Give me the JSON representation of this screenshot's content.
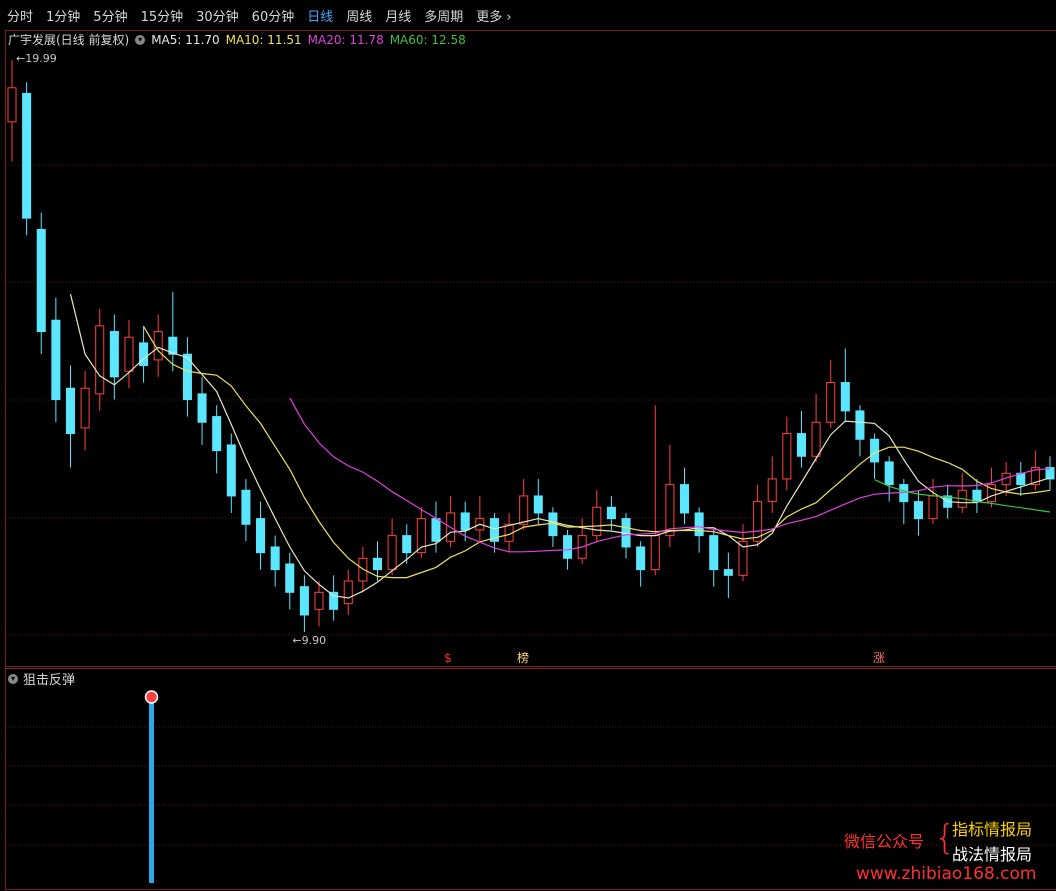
{
  "toolbar": {
    "tabs": [
      {
        "label": "分时",
        "active": false
      },
      {
        "label": "1分钟",
        "active": false
      },
      {
        "label": "5分钟",
        "active": false
      },
      {
        "label": "15分钟",
        "active": false
      },
      {
        "label": "30分钟",
        "active": false
      },
      {
        "label": "60分钟",
        "active": false
      },
      {
        "label": "日线",
        "active": true
      },
      {
        "label": "周线",
        "active": false
      },
      {
        "label": "月线",
        "active": false
      },
      {
        "label": "多周期",
        "active": false
      },
      {
        "label": "更多 ›",
        "active": false
      }
    ]
  },
  "main_chart": {
    "title": "广宇发展(日线 前复权)",
    "ma5": "MA5: 11.70",
    "ma10": "MA10: 11.51",
    "ma20": "MA20: 11.78",
    "ma60": "MA60: 12.58",
    "high_label": "19.99",
    "low_label": "9.90",
    "markers": [
      {
        "text": "$",
        "color": "#ff3030"
      },
      {
        "text": "榜",
        "color": "#ffd27a"
      },
      {
        "text": "涨",
        "color": "#ff7070"
      }
    ]
  },
  "sub_chart": {
    "title": "狙击反弹"
  },
  "watermark": {
    "left": "微信公众号",
    "line1": "指标情报局",
    "line2": "战法情报局",
    "url": "www.zhibiao168.com"
  },
  "colors": {
    "up": "#ff4040",
    "down": "#5ae6ff",
    "ma5": "#e8e8c0",
    "ma10": "#f0e060",
    "ma20": "#e040e0",
    "ma60": "#40c040",
    "active_tab": "#3fa9ff",
    "signal_bar": "#2da8e8"
  },
  "chart_data": {
    "type": "candlestick",
    "y_high": 19.99,
    "y_low": 9.9,
    "bars": [
      [
        18.9,
        19.5,
        19.99,
        18.2
      ],
      [
        19.4,
        17.2,
        19.6,
        16.9
      ],
      [
        17.0,
        15.2,
        17.3,
        14.8
      ],
      [
        15.4,
        14.0,
        15.8,
        13.6
      ],
      [
        14.2,
        13.4,
        14.6,
        12.8
      ],
      [
        13.5,
        14.2,
        14.5,
        13.1
      ],
      [
        14.1,
        15.3,
        15.6,
        13.8
      ],
      [
        15.2,
        14.4,
        15.5,
        14.0
      ],
      [
        14.5,
        15.1,
        15.4,
        14.2
      ],
      [
        15.0,
        14.6,
        15.3,
        14.3
      ],
      [
        14.7,
        15.2,
        15.5,
        14.4
      ],
      [
        15.1,
        14.8,
        15.9,
        14.5
      ],
      [
        14.8,
        14.0,
        15.1,
        13.7
      ],
      [
        14.1,
        13.6,
        14.4,
        13.2
      ],
      [
        13.7,
        13.1,
        13.9,
        12.7
      ],
      [
        13.2,
        12.3,
        13.4,
        12.0
      ],
      [
        12.4,
        11.8,
        12.6,
        11.5
      ],
      [
        11.9,
        11.3,
        12.2,
        11.0
      ],
      [
        11.4,
        11.0,
        11.6,
        10.7
      ],
      [
        11.1,
        10.6,
        11.3,
        10.3
      ],
      [
        10.7,
        10.2,
        10.9,
        9.9
      ],
      [
        10.3,
        10.6,
        10.8,
        10.0
      ],
      [
        10.6,
        10.3,
        10.9,
        10.1
      ],
      [
        10.4,
        10.8,
        11.0,
        10.2
      ],
      [
        10.8,
        11.2,
        11.4,
        10.6
      ],
      [
        11.2,
        11.0,
        11.5,
        10.8
      ],
      [
        11.0,
        11.6,
        11.9,
        10.9
      ],
      [
        11.6,
        11.3,
        11.8,
        11.1
      ],
      [
        11.3,
        11.9,
        12.1,
        11.2
      ],
      [
        11.9,
        11.5,
        12.2,
        11.3
      ],
      [
        11.5,
        12.0,
        12.3,
        11.4
      ],
      [
        12.0,
        11.7,
        12.2,
        11.5
      ],
      [
        11.7,
        11.9,
        12.3,
        11.5
      ],
      [
        11.9,
        11.5,
        12.0,
        11.3
      ],
      [
        11.5,
        11.8,
        12.0,
        11.3
      ],
      [
        11.8,
        12.3,
        12.6,
        11.7
      ],
      [
        12.3,
        12.0,
        12.6,
        11.8
      ],
      [
        12.0,
        11.6,
        12.1,
        11.4
      ],
      [
        11.6,
        11.2,
        11.7,
        11.0
      ],
      [
        11.2,
        11.6,
        11.9,
        11.1
      ],
      [
        11.6,
        12.1,
        12.4,
        11.5
      ],
      [
        12.1,
        11.9,
        12.3,
        11.7
      ],
      [
        11.9,
        11.4,
        12.0,
        11.2
      ],
      [
        11.4,
        11.0,
        11.5,
        10.7
      ],
      [
        11.0,
        11.6,
        13.9,
        10.9
      ],
      [
        11.6,
        12.5,
        13.2,
        11.4
      ],
      [
        12.5,
        12.0,
        12.8,
        11.8
      ],
      [
        12.0,
        11.6,
        12.1,
        11.3
      ],
      [
        11.6,
        11.0,
        11.7,
        10.7
      ],
      [
        11.0,
        10.9,
        11.3,
        10.5
      ],
      [
        10.9,
        11.5,
        11.8,
        10.8
      ],
      [
        11.5,
        12.2,
        12.5,
        11.4
      ],
      [
        12.2,
        12.6,
        13.0,
        12.0
      ],
      [
        12.6,
        13.4,
        13.7,
        12.4
      ],
      [
        13.4,
        13.0,
        13.8,
        12.8
      ],
      [
        13.0,
        13.6,
        14.1,
        12.9
      ],
      [
        13.6,
        14.3,
        14.7,
        13.5
      ],
      [
        14.3,
        13.8,
        14.9,
        13.6
      ],
      [
        13.8,
        13.3,
        13.9,
        13.0
      ],
      [
        13.3,
        12.9,
        13.4,
        12.6
      ],
      [
        12.9,
        12.5,
        13.0,
        12.2
      ],
      [
        12.5,
        12.2,
        12.6,
        11.8
      ],
      [
        12.2,
        11.9,
        12.4,
        11.6
      ],
      [
        11.9,
        12.3,
        12.6,
        11.8
      ],
      [
        12.3,
        12.1,
        12.5,
        11.9
      ],
      [
        12.1,
        12.4,
        12.7,
        12.0
      ],
      [
        12.4,
        12.2,
        12.6,
        12.0
      ],
      [
        12.2,
        12.5,
        12.8,
        12.1
      ],
      [
        12.5,
        12.7,
        12.9,
        12.3
      ],
      [
        12.7,
        12.5,
        12.9,
        12.3
      ],
      [
        12.5,
        12.8,
        13.1,
        12.4
      ],
      [
        12.8,
        12.6,
        13.0,
        12.4
      ]
    ],
    "signal": {
      "type": "bar",
      "label": "狙击反弹"
    }
  }
}
